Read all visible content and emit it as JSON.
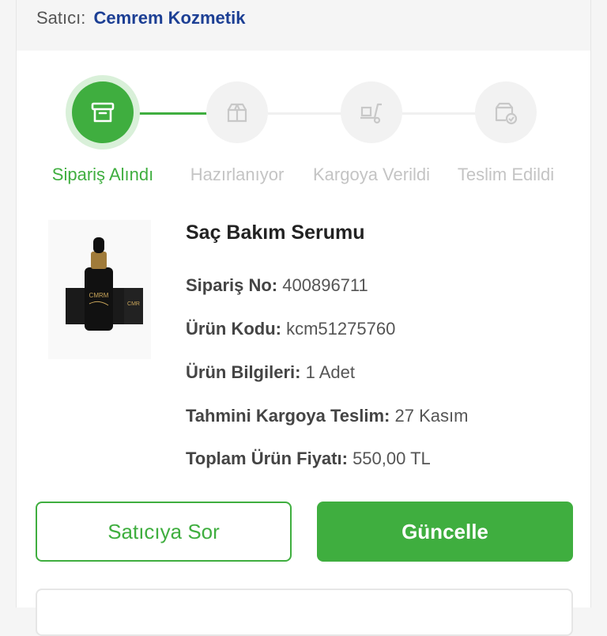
{
  "seller": {
    "label": "Satıcı:",
    "name": "Cemrem Kozmetik"
  },
  "steps": [
    {
      "label": "Sipariş Alındı",
      "icon": "archive-box-icon",
      "active": true
    },
    {
      "label": "Hazırlanıyor",
      "icon": "open-box-icon",
      "active": false
    },
    {
      "label": "Kargoya Verildi",
      "icon": "shipping-trolley-icon",
      "active": false
    },
    {
      "label": "Teslim Edildi",
      "icon": "delivered-box-icon",
      "active": false
    }
  ],
  "product": {
    "title": "Saç Bakım Serumu",
    "order_no": {
      "key": "Sipariş No:",
      "value": "400896711"
    },
    "product_code": {
      "key": "Ürün Kodu:",
      "value": "kcm51275760"
    },
    "product_info": {
      "key": "Ürün Bilgileri:",
      "value": "1 Adet"
    },
    "estimated_shipping": {
      "key": "Tahmini Kargoya Teslim:",
      "value": "27 Kasım"
    },
    "total_price": {
      "key": "Toplam Ürün Fiyatı:",
      "value": "550,00 TL"
    }
  },
  "actions": {
    "ask_seller": "Satıcıya Sor",
    "update": "Güncelle"
  },
  "colors": {
    "accent": "#3fae3f",
    "seller_link": "#1c3f94",
    "inactive": "#c4c4c4"
  }
}
